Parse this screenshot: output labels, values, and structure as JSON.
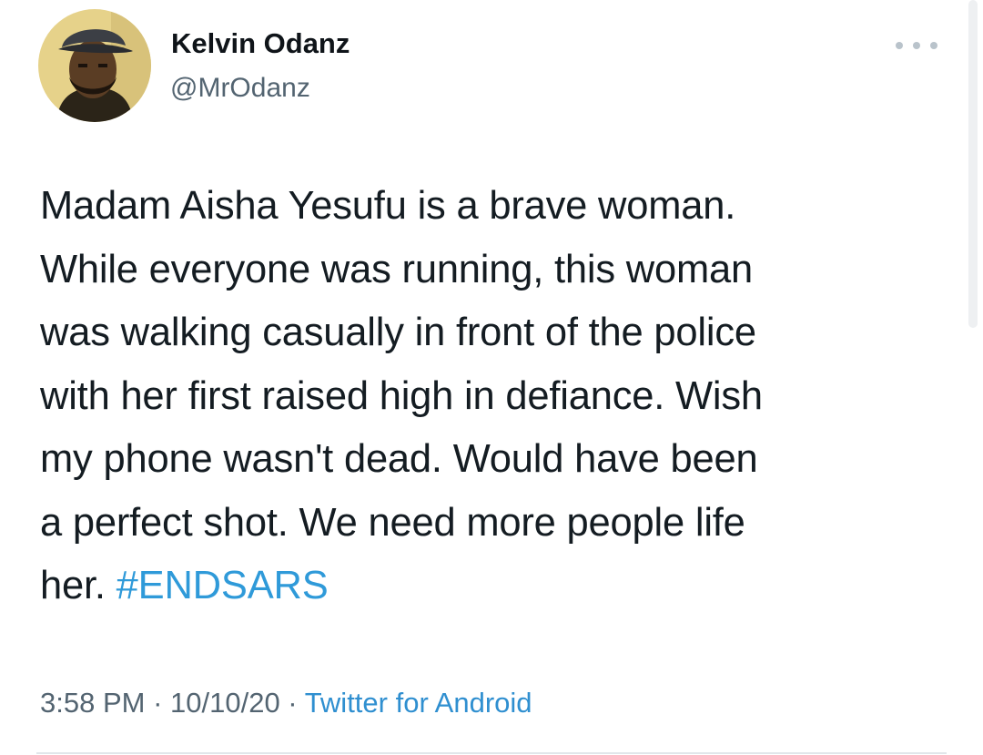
{
  "author": {
    "display_name": "Kelvin Odanz",
    "handle": "@MrOdanz",
    "avatar_icon": "profile-photo"
  },
  "more_icon": "more-horizontal-icon",
  "tweet": {
    "text": "Madam Aisha Yesufu is a brave woman.\nWhile everyone was running, this woman\nwas walking casually in front of the police\nwith her first raised high in defiance. Wish\nmy phone wasn't dead. Would have been\na perfect shot. We need more people life\nher. ",
    "hashtag": "#ENDSARS",
    "hashtag_color": "#2f9ad9"
  },
  "meta": {
    "time": "3:58 PM",
    "sep1": " · ",
    "date": "10/10/20",
    "sep2": " · ",
    "source": "Twitter for Android",
    "source_color": "#2f8fd0"
  }
}
